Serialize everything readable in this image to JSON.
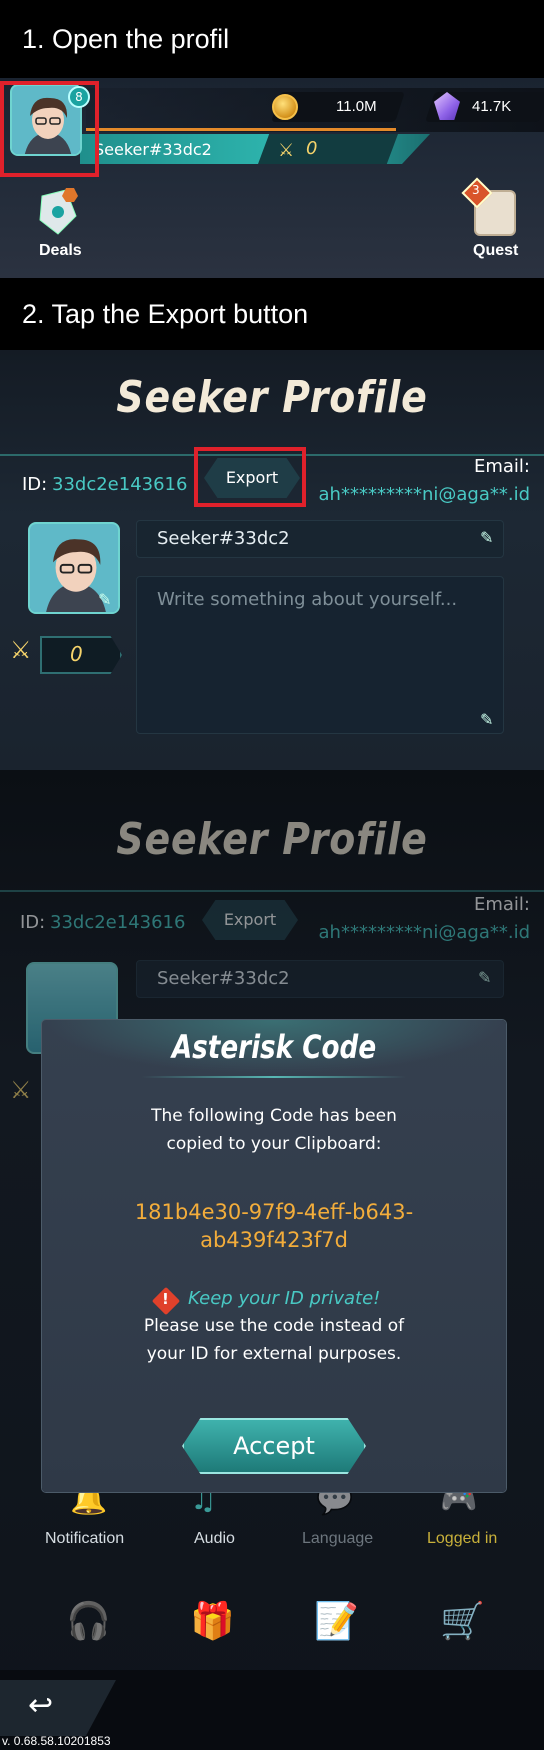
{
  "captions": {
    "step1": "1. Open the profil",
    "step2": "2. Tap the Export button"
  },
  "hud": {
    "level": "8",
    "gold": "11.0M",
    "gems": "41.7K",
    "player_name": "Seeker#33dc2",
    "rank": "0",
    "deals_label": "Deals",
    "quest_label": "Quest",
    "quest_badge": "3"
  },
  "profile": {
    "title": "Seeker Profile",
    "id_label": "ID:",
    "id_value": "33dc2e143616",
    "export_label": "Export",
    "email_label": "Email:",
    "email_value": "ah*********ni@aga**.id",
    "name_value": "Seeker#33dc2",
    "bio_placeholder": "Write something about yourself...",
    "rank_value": "0"
  },
  "dialog": {
    "title": "Asterisk Code",
    "message_line1": "The following Code has been",
    "message_line2": "copied to your Clipboard:",
    "code_line1": "181b4e30-97f9-4eff-b643-",
    "code_line2": "ab439f423f7d",
    "warning_title": "Keep your ID private!",
    "warning_line1": "Please use the code instead of",
    "warning_line2": "your ID for external purposes.",
    "accept_label": "Accept"
  },
  "settings": {
    "notification": "Notification",
    "audio": "Audio",
    "language": "Language",
    "logged_in": "Logged in"
  },
  "footer": {
    "version": "v. 0.68.58.10201853"
  },
  "colors": {
    "accent_teal": "#49c9c4",
    "code_orange": "#f3ad3b",
    "highlight_red": "#e0212b",
    "logged_in_yellow": "#c9b13a"
  }
}
